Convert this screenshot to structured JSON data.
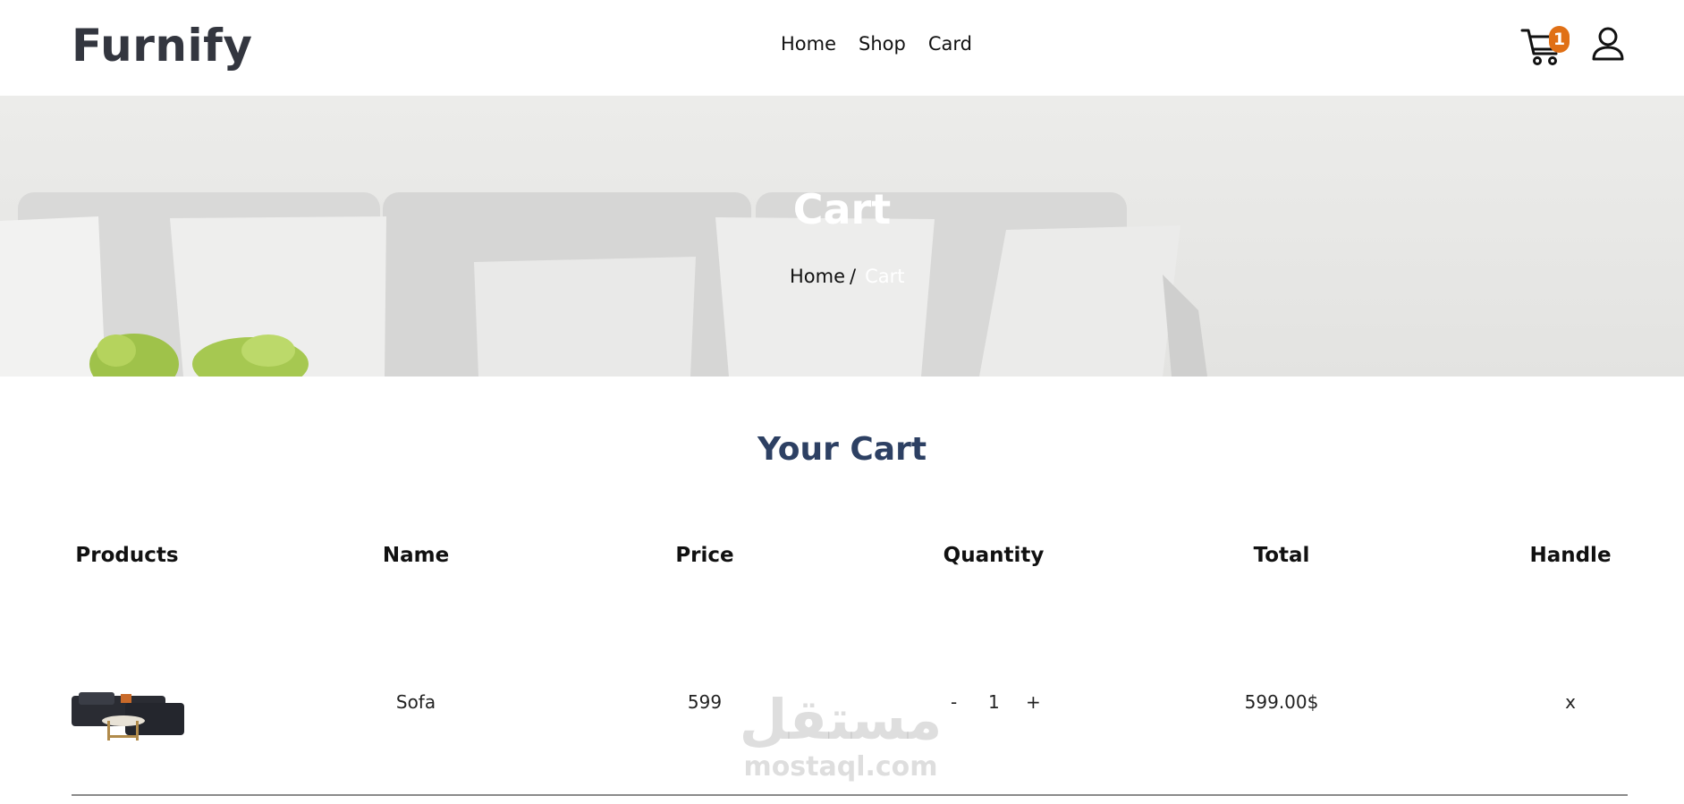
{
  "header": {
    "logo": "Furnify",
    "nav": [
      {
        "label": "Home"
      },
      {
        "label": "Shop"
      },
      {
        "label": "Card"
      }
    ],
    "cart_count": "1",
    "icons": {
      "cart": "shopping-cart-icon",
      "user": "user-icon"
    },
    "accent_color": "#e07016"
  },
  "hero": {
    "title": "Cart",
    "breadcrumb": {
      "home": "Home",
      "separator": "/",
      "current": "Cart"
    }
  },
  "cart": {
    "heading": "Your Cart",
    "heading_color": "#2d4063",
    "columns": [
      "Products",
      "Name",
      "Price",
      "Quantity",
      "Total",
      "Handle"
    ],
    "rows": [
      {
        "product_image": "sofa-thumbnail",
        "name": "Sofa",
        "price": "599",
        "qty_minus": "-",
        "quantity": "1",
        "qty_plus": "+",
        "total": "599.00$",
        "handle": "x"
      }
    ]
  },
  "watermark": {
    "arabic": "مستقل",
    "latin": "mostaql.com"
  }
}
